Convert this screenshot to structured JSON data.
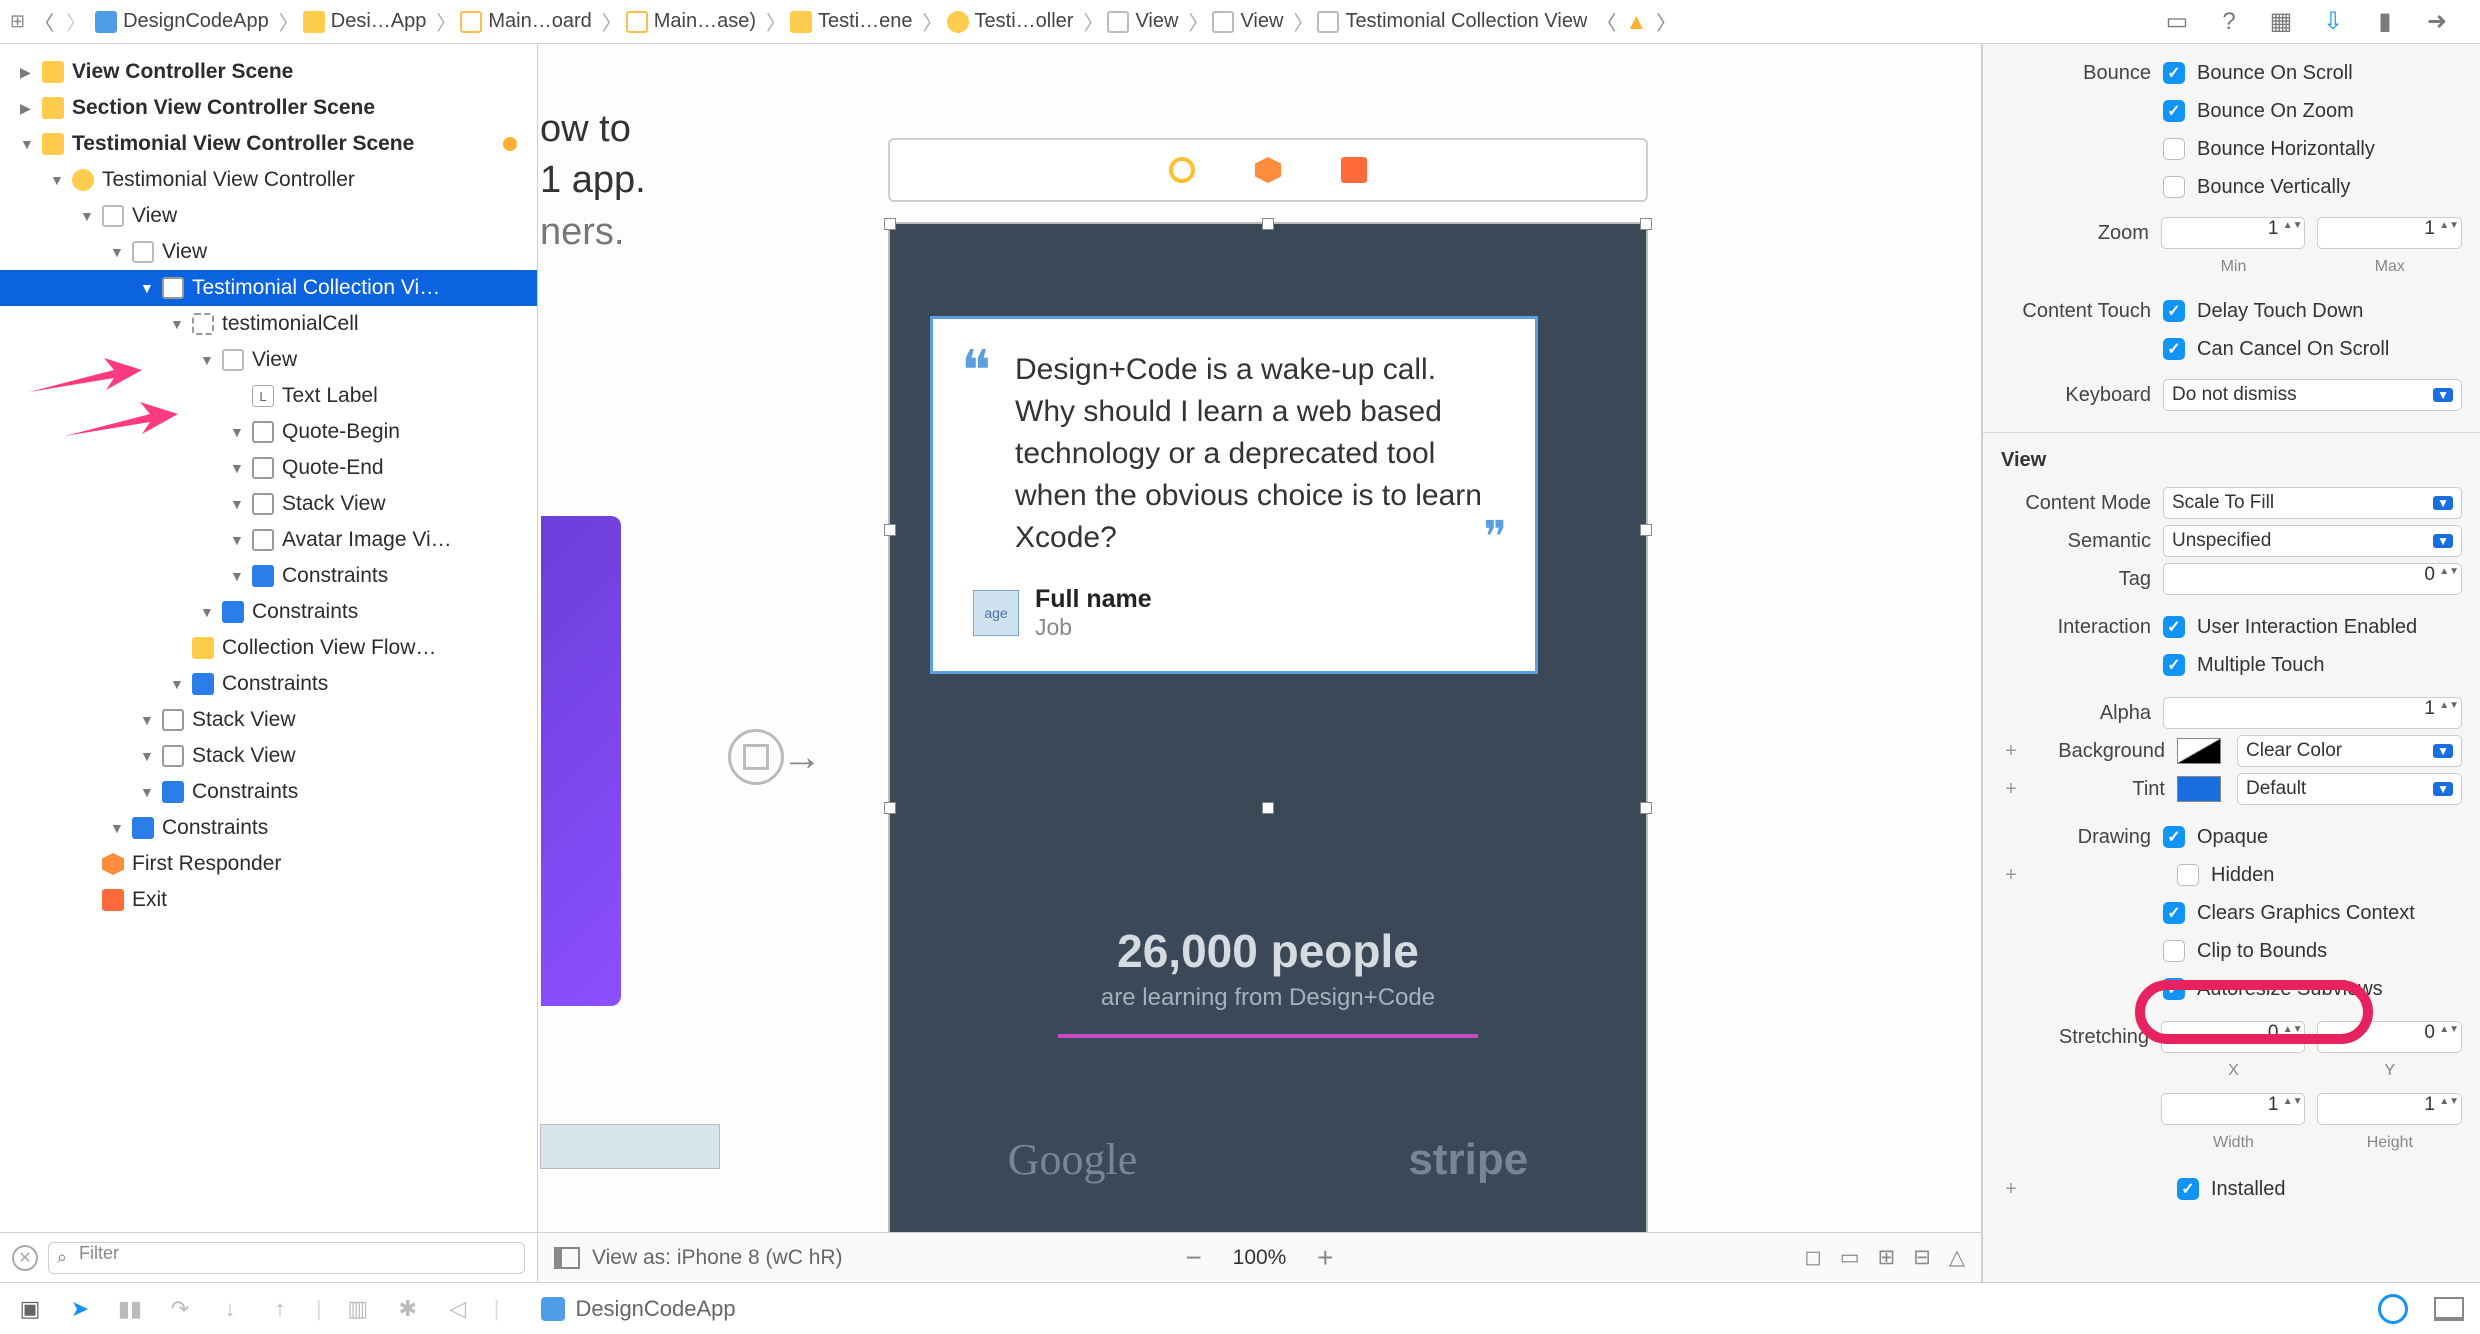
{
  "breadcrumb": {
    "items": [
      {
        "label": "DesignCodeApp",
        "icon": "proj"
      },
      {
        "label": "Desi…App",
        "icon": "folder"
      },
      {
        "label": "Main…oard",
        "icon": "sb"
      },
      {
        "label": "Main…ase)",
        "icon": "sb"
      },
      {
        "label": "Testi…ene",
        "icon": "scene"
      },
      {
        "label": "Testi…oller",
        "icon": "vc"
      },
      {
        "label": "View",
        "icon": "view"
      },
      {
        "label": "View",
        "icon": "view"
      },
      {
        "label": "Testimonial Collection View",
        "icon": "cv"
      }
    ]
  },
  "outline": {
    "scenes": [
      {
        "label": "View Controller Scene",
        "icon": "scene",
        "indent": 0
      },
      {
        "label": "Section View Controller Scene",
        "icon": "scene",
        "indent": 0
      },
      {
        "label": "Testimonial View Controller Scene",
        "icon": "scene",
        "indent": 0,
        "badge": true
      },
      {
        "label": "Testimonial View Controller",
        "icon": "vc",
        "indent": 1
      },
      {
        "label": "View",
        "icon": "view",
        "indent": 2
      },
      {
        "label": "View",
        "icon": "view",
        "indent": 3
      },
      {
        "label": "Testimonial Collection Vi…",
        "icon": "cv",
        "indent": 4,
        "selected": true
      },
      {
        "label": "testimonialCell",
        "icon": "cell",
        "indent": 5
      },
      {
        "label": "View",
        "icon": "view",
        "indent": 6
      },
      {
        "label": "Text Label",
        "icon": "label",
        "indent": 7,
        "leaf": true
      },
      {
        "label": "Quote-Begin",
        "icon": "img",
        "indent": 7
      },
      {
        "label": "Quote-End",
        "icon": "img",
        "indent": 7
      },
      {
        "label": "Stack View",
        "icon": "stack",
        "indent": 7
      },
      {
        "label": "Avatar Image Vi…",
        "icon": "img",
        "indent": 7
      },
      {
        "label": "Constraints",
        "icon": "constraint",
        "indent": 7
      },
      {
        "label": "Constraints",
        "icon": "constraint",
        "indent": 6
      },
      {
        "label": "Collection View Flow…",
        "icon": "flow",
        "indent": 5,
        "leaf": true
      },
      {
        "label": "Constraints",
        "icon": "constraint",
        "indent": 5
      },
      {
        "label": "Stack View",
        "icon": "stack",
        "indent": 4
      },
      {
        "label": "Stack View",
        "icon": "stack",
        "indent": 4
      },
      {
        "label": "Constraints",
        "icon": "constraint",
        "indent": 4
      },
      {
        "label": "Constraints",
        "icon": "constraint",
        "indent": 3
      },
      {
        "label": "First Responder",
        "icon": "first",
        "indent": 2,
        "leaf": true
      },
      {
        "label": "Exit",
        "icon": "exit",
        "indent": 2,
        "leaf": true
      }
    ],
    "filter_placeholder": "Filter"
  },
  "canvas": {
    "partial_text_l1": "ow to",
    "partial_text_l2": "1 app.",
    "partial_text_l3": "ners.",
    "quote_text": "Design+Code is a wake-up call. Why should I learn a web based technology or a deprecated tool when the obvious choice is to learn Xcode?",
    "author_name": "Full name",
    "author_job": "Job",
    "avatar_placeholder": "age",
    "count_big": "26,000 people",
    "count_sub": "are learning from Design+Code",
    "logos": [
      "Google",
      "",
      "stripe"
    ],
    "view_as": "View as: iPhone 8 (wC hR)",
    "zoom": "100%"
  },
  "inspector": {
    "bounce": {
      "label": "Bounce",
      "scroll": "Bounce On Scroll",
      "zoom": "Bounce On Zoom",
      "horiz": "Bounce Horizontally",
      "vert": "Bounce Vertically"
    },
    "zoom": {
      "label": "Zoom",
      "min": "1",
      "max": "1",
      "min_lbl": "Min",
      "max_lbl": "Max"
    },
    "content_touch": {
      "label": "Content Touch",
      "delay": "Delay Touch Down",
      "cancel": "Can Cancel On Scroll"
    },
    "keyboard": {
      "label": "Keyboard",
      "value": "Do not dismiss"
    },
    "view_section": "View",
    "content_mode": {
      "label": "Content Mode",
      "value": "Scale To Fill"
    },
    "semantic": {
      "label": "Semantic",
      "value": "Unspecified"
    },
    "tag": {
      "label": "Tag",
      "value": "0"
    },
    "interaction": {
      "label": "Interaction",
      "ui": "User Interaction Enabled",
      "mt": "Multiple Touch"
    },
    "alpha": {
      "label": "Alpha",
      "value": "1"
    },
    "background": {
      "label": "Background",
      "value": "Clear Color"
    },
    "tint": {
      "label": "Tint",
      "value": "Default"
    },
    "drawing": {
      "label": "Drawing",
      "opaque": "Opaque",
      "hidden": "Hidden",
      "clears": "Clears Graphics Context",
      "clip": "Clip to Bounds",
      "autoresize": "Autoresize Subviews"
    },
    "stretching": {
      "label": "Stretching",
      "x": "0",
      "y": "0",
      "w": "1",
      "h": "1",
      "x_lbl": "X",
      "y_lbl": "Y",
      "w_lbl": "Width",
      "h_lbl": "Height"
    },
    "installed": "Installed"
  },
  "debugbar": {
    "app": "DesignCodeApp"
  }
}
